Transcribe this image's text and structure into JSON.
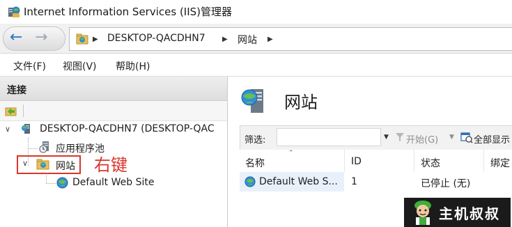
{
  "window": {
    "title": "Internet Information Services (IIS)管理器"
  },
  "navigation": {
    "breadcrumbs": [
      "DESKTOP-QACDHN7",
      "网站"
    ]
  },
  "menu": {
    "items": [
      "文件(F)",
      "视图(V)",
      "帮助(H)"
    ]
  },
  "connections": {
    "title": "连接",
    "tree": {
      "server": "DESKTOP-QACDHN7 (DESKTOP-QAC",
      "app_pools": "应用程序池",
      "sites": "网站",
      "default_site": "Default Web Site"
    }
  },
  "annotation": {
    "label": "右键",
    "color": "#d9362b"
  },
  "content": {
    "title": "网站",
    "filter": {
      "label": "筛选:",
      "value": ""
    },
    "actions": {
      "start": "开始(G)",
      "show_all": "全部显示"
    },
    "table": {
      "columns": [
        "名称",
        "ID",
        "状态",
        "绑定"
      ],
      "rows": [
        {
          "name": "Default Web S...",
          "id": "1",
          "status": "已停止 (无)"
        }
      ]
    }
  },
  "watermark": {
    "text": "主机叔叔"
  },
  "icons": [
    "iis-app-icon",
    "back-arrow-icon",
    "forward-arrow-icon",
    "site-globe-icon",
    "server-icon",
    "app-pool-icon",
    "filter-funnel-icon",
    "show-all-icon",
    "mascot-icon"
  ]
}
